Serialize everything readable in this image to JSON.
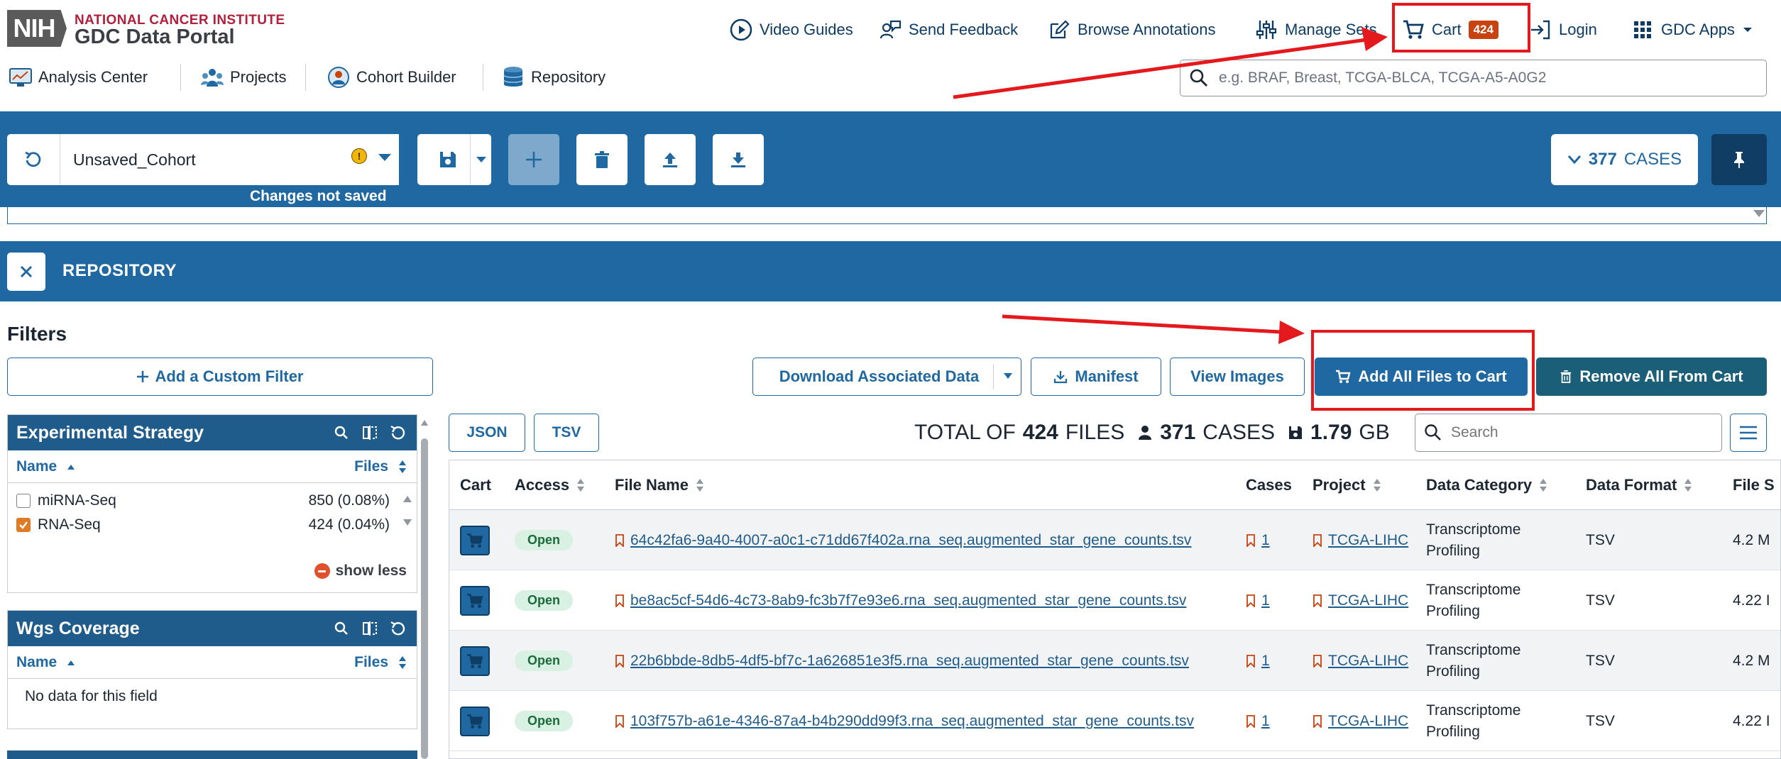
{
  "header": {
    "nih_logo": "NIH",
    "institute": "NATIONAL CANCER INSTITUTE",
    "portal": "GDC Data Portal",
    "nav": {
      "video_guides": "Video Guides",
      "send_feedback": "Send Feedback",
      "browse_annotations": "Browse Annotations",
      "manage_sets": "Manage Sets",
      "cart": "Cart",
      "cart_count": "424",
      "login": "Login",
      "gdc_apps": "GDC Apps"
    },
    "subnav": {
      "analysis_center": "Analysis Center",
      "projects": "Projects",
      "cohort_builder": "Cohort Builder",
      "repository": "Repository"
    },
    "search_placeholder": "e.g. BRAF, Breast, TCGA-BLCA, TCGA-A5-A0G2"
  },
  "cohort_bar": {
    "cohort_name": "Unsaved_Cohort",
    "changes_note": "Changes not saved",
    "cases_count": "377",
    "cases_label": "CASES"
  },
  "repository": {
    "title": "REPOSITORY"
  },
  "filters": {
    "heading": "Filters",
    "add_custom_filter": "Add a Custom Filter",
    "facets": [
      {
        "title": "Experimental Strategy",
        "col_name": "Name",
        "col_files": "Files",
        "rows": [
          {
            "label": "miRNA-Seq",
            "count": "850 (0.08%)",
            "checked": false
          },
          {
            "label": "RNA-Seq",
            "count": "424 (0.04%)",
            "checked": true
          }
        ],
        "show_less": "show less"
      },
      {
        "title": "Wgs Coverage",
        "col_name": "Name",
        "col_files": "Files",
        "empty_text": "No data for this field"
      }
    ]
  },
  "actions": {
    "download_associated": "Download Associated Data",
    "manifest": "Manifest",
    "view_images": "View Images",
    "add_all_to_cart": "Add All Files to Cart",
    "remove_all_from_cart": "Remove All From Cart"
  },
  "table_toolbar": {
    "json": "JSON",
    "tsv": "TSV",
    "total_prefix": "TOTAL OF",
    "total_files": "424",
    "files_label": "FILES",
    "total_cases": "371",
    "cases_label": "CASES",
    "total_size": "1.79",
    "size_unit": "GB",
    "search_placeholder": "Search"
  },
  "table": {
    "columns": [
      "Cart",
      "Access",
      "File Name",
      "Cases",
      "Project",
      "Data Category",
      "Data Format",
      "File S"
    ],
    "rows": [
      {
        "access": "Open",
        "file_name": "64c42fa6-9a40-4007-a0c1-c71dd67f402a.rna_seq.augmented_star_gene_counts.tsv",
        "cases": "1",
        "project": "TCGA-LIHC",
        "data_category": "Transcriptome Profiling",
        "data_format": "TSV",
        "file_size": "4.2 M"
      },
      {
        "access": "Open",
        "file_name": "be8ac5cf-54d6-4c73-8ab9-fc3b7f7e93e6.rna_seq.augmented_star_gene_counts.tsv",
        "cases": "1",
        "project": "TCGA-LIHC",
        "data_category": "Transcriptome Profiling",
        "data_format": "TSV",
        "file_size": "4.22 I"
      },
      {
        "access": "Open",
        "file_name": "22b6bbde-8db5-4df5-bf7c-1a626851e3f5.rna_seq.augmented_star_gene_counts.tsv",
        "cases": "1",
        "project": "TCGA-LIHC",
        "data_category": "Transcriptome Profiling",
        "data_format": "TSV",
        "file_size": "4.2 M"
      },
      {
        "access": "Open",
        "file_name": "103f757b-a61e-4346-87a4-b4b290dd99f3.rna_seq.augmented_star_gene_counts.tsv",
        "cases": "1",
        "project": "TCGA-LIHC",
        "data_category": "Transcriptome Profiling",
        "data_format": "TSV",
        "file_size": "4.22 I"
      }
    ]
  },
  "colors": {
    "primary": "#1f68a1",
    "dark_navy": "#0f3d64",
    "annotation_red": "#e3191d",
    "cart_badge": "#c8430f",
    "checked_orange": "#e07a24",
    "open_badge_bg": "#d9f1e3"
  }
}
